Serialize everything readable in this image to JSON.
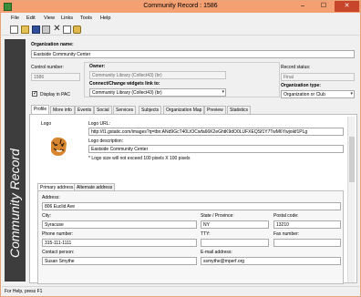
{
  "window": {
    "title": "Community Record : 1586",
    "minimize": "–",
    "maximize": "☐",
    "close": "✕"
  },
  "menu": [
    "File",
    "Edit",
    "View",
    "Links",
    "Tools",
    "Help"
  ],
  "sidebar": {
    "label": "Community Record"
  },
  "org": {
    "name_label": "Organization name:",
    "name_value": "Eastside Community Center",
    "control_label": "Control number:",
    "control_value": "1586",
    "display_label": "Display in PAC",
    "owner_label": "Owner:",
    "owner_value": "Community Library (Collect43) (br)",
    "connect_label": "Connect/Change widgets link to:",
    "connect_value": "Community Library (Collect43) (br)",
    "status_label": "Record status:",
    "status_value": "Final",
    "orgtype_label": "Organization type:",
    "orgtype_value": "Organization or Club"
  },
  "tabs": [
    "Profile",
    "More info",
    "Events",
    "Social",
    "Services",
    "Subjects",
    "Organization Map",
    "Preview",
    "Statistics"
  ],
  "profile": {
    "logo_label": "Logo",
    "logo_url_label": "Logo URL:",
    "logo_url_value": "http://t1.gstatic.com/images?q=tbn:ANd9GcT40LtOCwfa66K2eGhtK9dO0LUFXEQSf1Y7TwM6Ywjoikf1PLg",
    "logo_desc_label": "Logo description:",
    "logo_desc_value": "Eastside Community Center",
    "logo_note": "* Logo size will not exceed 100 pixels X 100 pixels"
  },
  "address_tabs": [
    "Primary address",
    "Alternate address"
  ],
  "address": {
    "address_label": "Address:",
    "address_value": "806 Euclid Ave",
    "city_label": "City:",
    "city_value": "Syracuse",
    "state_label": "State / Province:",
    "state_value": "NY",
    "postal_label": "Postal code:",
    "postal_value": "13210",
    "phone_label": "Phone number:",
    "phone_value": "315-111-1111",
    "tty_label": "TTY:",
    "tty_value": "",
    "fax_label": "Fax number:",
    "fax_value": "",
    "contact_label": "Contact person:",
    "contact_value": "Susan Smythe",
    "email_label": "E-mail address:",
    "email_value": "ssmythe@mperf.org"
  },
  "status": {
    "text": "For Help, press F1"
  }
}
